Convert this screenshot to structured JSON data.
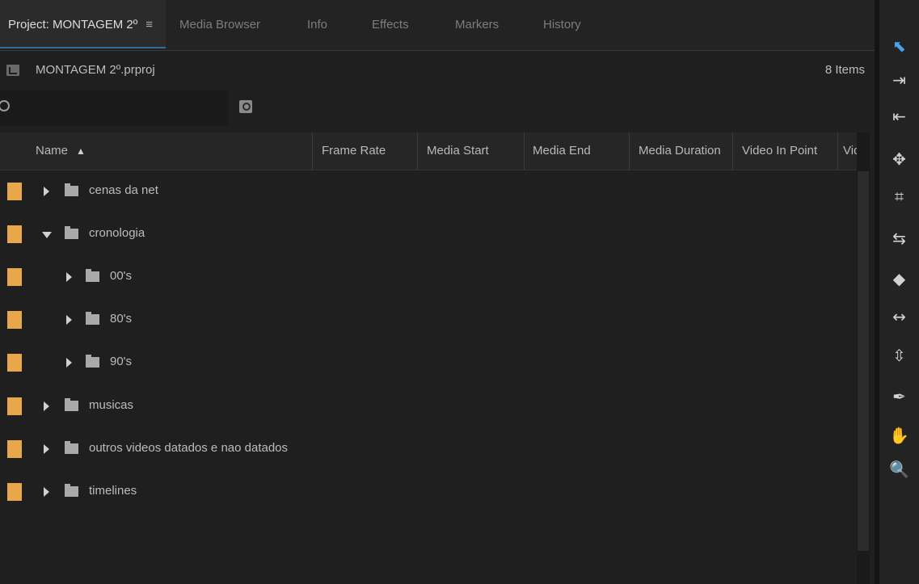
{
  "tabs": [
    {
      "label": "Project: MONTAGEM 2º",
      "menu_icon": "≡"
    },
    {
      "label": "Media Browser"
    },
    {
      "label": "Info"
    },
    {
      "label": "Effects"
    },
    {
      "label": "Markers"
    },
    {
      "label": "History"
    }
  ],
  "project": {
    "file_name": "MONTAGEM 2º.prproj",
    "item_count": "8 Items",
    "icon": "project-file-icon"
  },
  "search": {
    "value": "",
    "placeholder": "",
    "icon": "search-icon"
  },
  "columns": [
    {
      "label": "Name",
      "sort_indicator": "▲"
    },
    {
      "label": "Frame Rate"
    },
    {
      "label": "Media Start"
    },
    {
      "label": "Media End"
    },
    {
      "label": "Media Duration"
    },
    {
      "label": "Video In Point"
    },
    {
      "label": "Vid"
    }
  ],
  "items": [
    {
      "name": "cenas da net",
      "expanded": false,
      "depth": 0
    },
    {
      "name": "cronologia",
      "expanded": true,
      "depth": 0
    },
    {
      "name": "00's",
      "expanded": false,
      "depth": 1
    },
    {
      "name": "80's",
      "expanded": false,
      "depth": 1
    },
    {
      "name": "90's",
      "expanded": false,
      "depth": 1
    },
    {
      "name": "musicas",
      "expanded": false,
      "depth": 0
    },
    {
      "name": "outros videos datados e nao datados",
      "expanded": false,
      "depth": 0
    },
    {
      "name": "timelines",
      "expanded": false,
      "depth": 0
    }
  ],
  "colors": {
    "label_color": "#e8a74a",
    "active_tab_underline": "#2f6f9e",
    "selected_tool": "#4aa3e8"
  },
  "tools": [
    {
      "name": "selection-tool",
      "glyph": "⬉",
      "selected": true
    },
    {
      "name": "track-select-forward-tool",
      "glyph": "⇥"
    },
    {
      "name": "track-select-backward-tool",
      "glyph": "⇤"
    },
    {
      "name": "ripple-edit-tool",
      "glyph": "✥"
    },
    {
      "name": "rolling-edit-tool",
      "glyph": "⌗"
    },
    {
      "name": "rate-stretch-tool",
      "glyph": "⇆"
    },
    {
      "name": "razor-tool",
      "glyph": "◆"
    },
    {
      "name": "slip-tool",
      "glyph": "↔"
    },
    {
      "name": "slide-tool",
      "glyph": "⇳"
    },
    {
      "name": "pen-tool",
      "glyph": "✒"
    },
    {
      "name": "hand-tool",
      "glyph": "✋"
    },
    {
      "name": "zoom-tool",
      "glyph": "🔍"
    }
  ]
}
